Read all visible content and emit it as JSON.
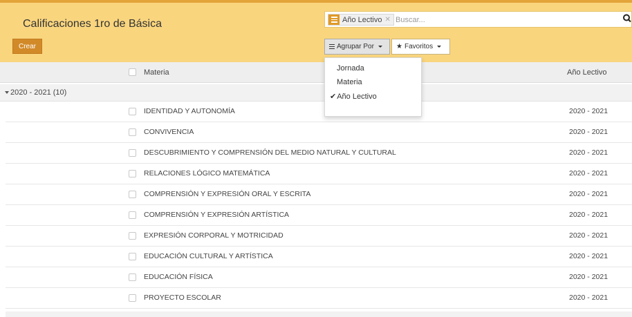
{
  "control_panel": {
    "title": "Calificaciones 1ro de Básica",
    "search": {
      "facet_label": "Año Lectivo",
      "facet_remove": "✕",
      "placeholder": "Buscar..."
    },
    "create_button": "Crear",
    "group_by_button": "Agrupar Por",
    "favorites_button": "Favoritos",
    "group_by_menu": [
      {
        "label": "Jornada",
        "checked": false
      },
      {
        "label": "Materia",
        "checked": false
      },
      {
        "label": "Año Lectivo",
        "checked": true
      }
    ],
    "colors": {
      "panel": "#f9d57e",
      "accent": "#d28a29",
      "topline": "#e3a43a"
    }
  },
  "list": {
    "columns": [
      "Materia",
      "Año Lectivo"
    ],
    "group": {
      "label": "2020 - 2021 (10)"
    },
    "rows": [
      {
        "materia": "IDENTIDAD Y AUTONOMÍA",
        "anio": "2020 - 2021"
      },
      {
        "materia": "CONVIVENCIA",
        "anio": "2020 - 2021"
      },
      {
        "materia": "DESCUBRIMIENTO Y COMPRENSIÓN DEL MEDIO NATURAL Y CULTURAL",
        "anio": "2020 - 2021"
      },
      {
        "materia": "RELACIONES LÓGICO MATEMÁTICA",
        "anio": "2020 - 2021"
      },
      {
        "materia": "COMPRENSIÓN Y EXPRESIÓN ORAL Y ESCRITA",
        "anio": "2020 - 2021"
      },
      {
        "materia": "COMPRENSIÓN Y EXPRESIÓN ARTÍSTICA",
        "anio": "2020 - 2021"
      },
      {
        "materia": "EXPRESIÓN CORPORAL Y MOTRICIDAD",
        "anio": "2020 - 2021"
      },
      {
        "materia": "EDUCACIÓN CULTURAL Y ARTÍSTICA",
        "anio": "2020 - 2021"
      },
      {
        "materia": "EDUCACIÓN FÍSICA",
        "anio": "2020 - 2021"
      },
      {
        "materia": "PROYECTO ESCOLAR",
        "anio": "2020 - 2021"
      }
    ]
  }
}
